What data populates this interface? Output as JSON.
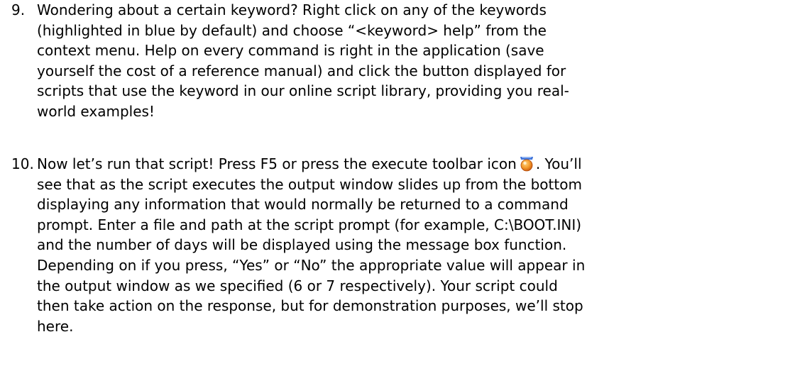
{
  "list": {
    "items": [
      {
        "number": "9.",
        "lines": [
          "Wondering about a certain keyword? Right click on any of the keywords",
          "(highlighted in blue by default) and choose “<keyword> help” from the",
          "context menu. Help on every command is right in the application (save",
          "yourself the cost of a reference manual) and click the button displayed for",
          "scripts that use the keyword in our online script library, providing you real-",
          "world examples!"
        ]
      },
      {
        "number": "10.",
        "first_line_before_icon": "Now let’s run that script! Press F5 or press the execute toolbar icon",
        "first_line_after_icon": ". You’ll",
        "icon": "execute-script-icon",
        "lines": [
          "see that as the script executes the output window slides up from the bottom",
          "displaying any information that would normally be returned to a command",
          "prompt. Enter a file and path at the script prompt (for example, C:\\BOOT.INI)",
          "and the number of days will be displayed using the message box function.",
          "Depending on if you press, “Yes” or “No” the appropriate value will appear in",
          "the output window as we specified (6 or 7 respectively). Your script could",
          "then take action on the response, but for demonstration purposes, we’ll stop",
          "here."
        ]
      }
    ]
  },
  "colors": {
    "text": "#000000",
    "background": "#ffffff",
    "icon_orange": "#f07c1a",
    "icon_blue": "#3a6fd8"
  }
}
